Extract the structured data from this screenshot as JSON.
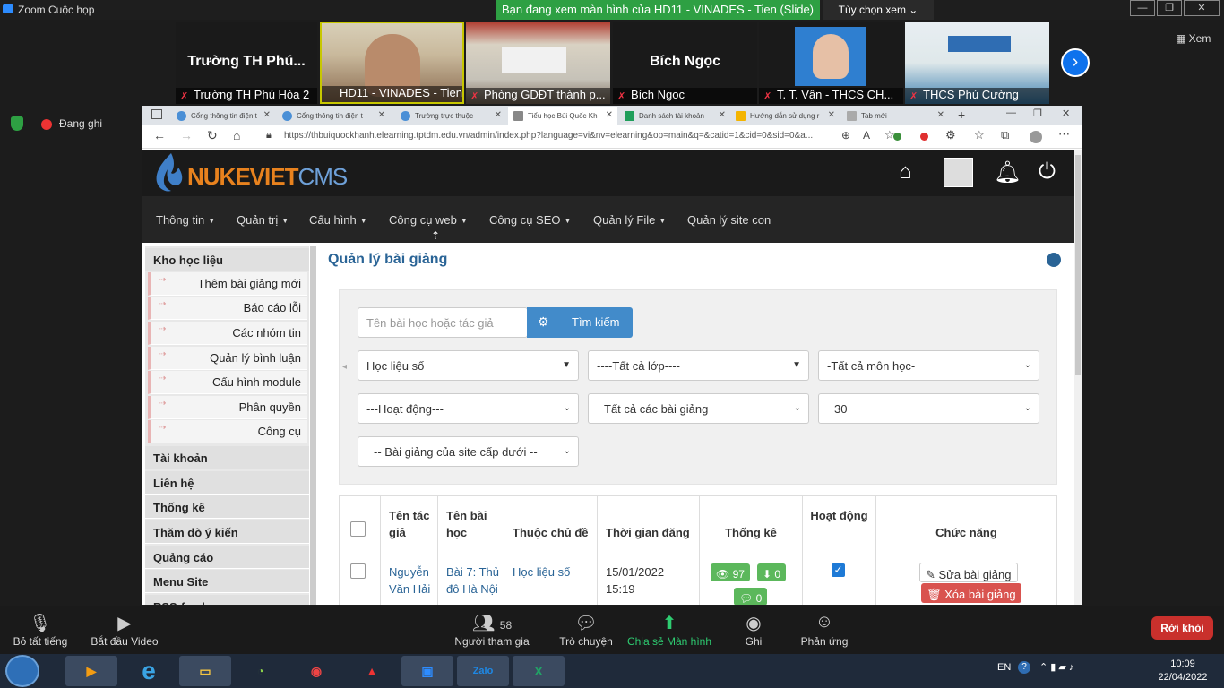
{
  "zoom": {
    "window_title": "Zoom Cuộc họp",
    "share_banner": "Bạn đang xem màn hình của HD11 - VINADES - Tien (Slide)",
    "view_options": "Tùy chọn xem ⌄",
    "view_button": "Xem",
    "recording": "Đang ghi",
    "participants": [
      {
        "big_name": "Trường TH Phú...",
        "label": "Trường TH Phú Hòa 2"
      },
      {
        "big_name": "",
        "label": "HD11 - VINADES - Tien (..."
      },
      {
        "big_name": "",
        "label": "Phòng GDĐT thành p..."
      },
      {
        "big_name": "Bích Ngọc",
        "label": "Bích Ngoc"
      },
      {
        "big_name": "",
        "label": "T. T. Vân  - THCS CH..."
      },
      {
        "big_name": "",
        "label": "THCS Phú Cường"
      }
    ],
    "toolbar": {
      "mute": "Bỏ tất tiếng",
      "video": "Bắt đầu Video",
      "participants": "Người tham gia",
      "participants_count": "58",
      "chat": "Trò chuyện",
      "share": "Chia sẻ Màn hình",
      "record": "Ghi",
      "reactions": "Phản ứng",
      "leave": "Rời khỏi"
    }
  },
  "browser": {
    "tabs": [
      "Cổng thông tin điện t",
      "Cổng thông tin điện t",
      "Trường trực thuộc",
      "Tiểu học Bùi Quốc Kh",
      "Danh sách tài khoản",
      "Hướng dẫn sử dụng r",
      "Tab mới"
    ],
    "url": "https://thbuiquockhanh.elearning.tptdm.edu.vn/admin/index.php?language=vi&nv=elearning&op=main&q=&catid=1&cid=0&sid=0&a..."
  },
  "site": {
    "logo_main": "NUKEVIET",
    "logo_sub": "CMS",
    "menu": [
      "Thông tin",
      "Quản trị",
      "Cấu hình",
      "Công cụ web",
      "Công cụ SEO",
      "Quản lý File",
      "Quản lý site con"
    ],
    "sidebar": {
      "group1": "Kho học liệu",
      "items": [
        "Thêm bài giảng mới",
        "Báo cáo lỗi",
        "Các nhóm tin",
        "Quản lý bình luận",
        "Cấu hình module",
        "Phân quyền",
        "Công cụ"
      ],
      "groups": [
        "Tài khoản",
        "Liên hệ",
        "Thống kê",
        "Thăm dò ý kiến",
        "Quảng cáo",
        "Menu Site",
        "RSS-feeds"
      ]
    },
    "page_title": "Quản lý bài giảng",
    "filters": {
      "search_placeholder": "Tên bài học hoặc tác giả",
      "search_button": "Tìm kiếm",
      "source": "Học liệu số",
      "grade": "----Tất cả lớp----",
      "subject": "-Tất cả môn học-",
      "status": "---Hoạt động---",
      "lectures": "Tất cả các bài giảng",
      "per_page": "30",
      "subsite": "-- Bài giảng của site cấp dưới --"
    },
    "table": {
      "headers": [
        "Tên tác giả",
        "Tên bài học",
        "Thuộc chủ đề",
        "Thời gian đăng",
        "Thống kê",
        "Hoạt động",
        "Chức năng"
      ],
      "row": {
        "author": "Nguyễn Văn Hải",
        "lesson": "Bài 7: Thủ đô Hà Nội",
        "topic": "Học liệu số",
        "posted": "15/01/2022 15:19",
        "views": "97",
        "downloads": "0",
        "comments": "0",
        "edit": "Sửa bài giảng",
        "delete": "Xóa bài giảng"
      }
    }
  },
  "taskbar": {
    "lang": "EN",
    "time": "10:09",
    "date": "22/04/2022"
  }
}
